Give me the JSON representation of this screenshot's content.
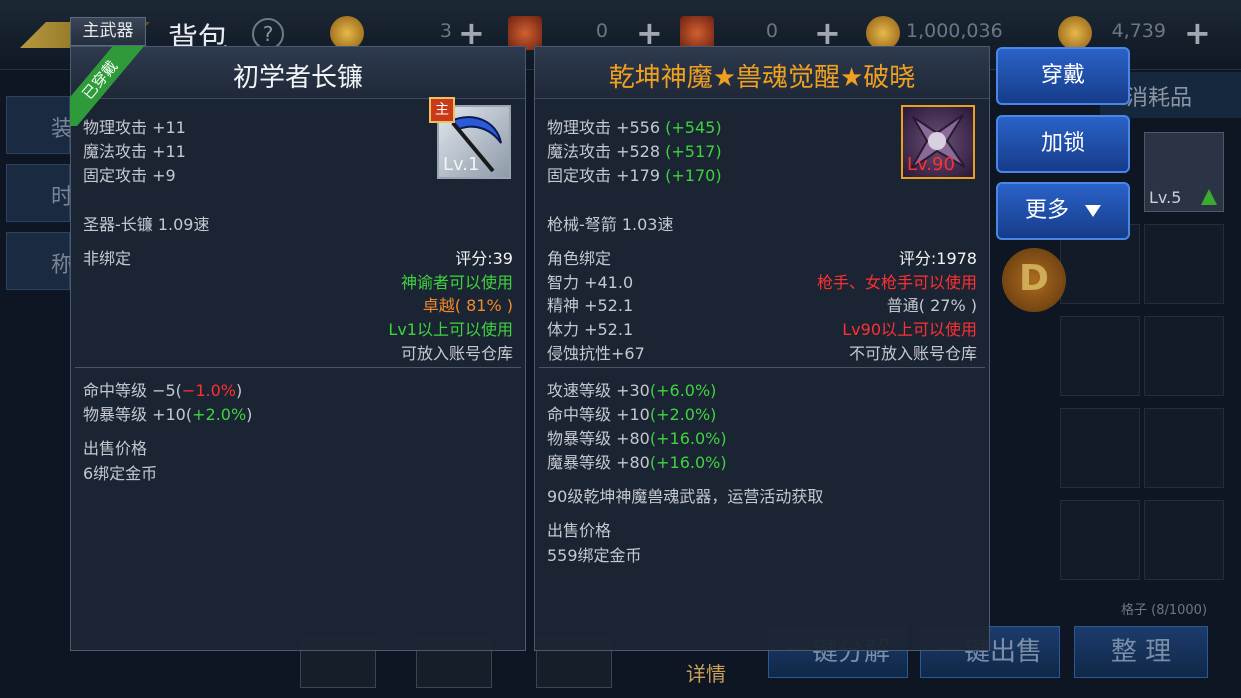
{
  "background": {
    "title": "背包",
    "help": "?",
    "resources": [
      {
        "icon": "coin-icon",
        "value": "3"
      },
      {
        "icon": "scroll-icon",
        "value": "0"
      },
      {
        "icon": "scroll-icon",
        "value": "0"
      },
      {
        "icon": "gold-coin-icon",
        "value": "1,000,036"
      },
      {
        "icon": "coin-icon",
        "value": "4,739"
      }
    ],
    "plus": "+",
    "side_tabs": [
      "装",
      "时",
      "称"
    ],
    "tab_consumables": "消耗品",
    "slot_level": "Lv.5",
    "d_badge": "D",
    "grid_count": "格子 (8/1000)",
    "bottom_buttons": [
      "一键分解",
      "一键出售",
      "整 理"
    ],
    "detail_label": "详情"
  },
  "left_item": {
    "equipped_tab": "主武器",
    "ribbon": "已穿戴",
    "name": "初学者长镰",
    "main_badge": "主",
    "icon_level": "Lv.1",
    "stats": [
      "物理攻击 +11",
      "魔法攻击 +11",
      "固定攻击 +9"
    ],
    "type_speed": "圣器-长镰 1.09速",
    "binding": "非绑定",
    "score": "评分:39",
    "usable_by": "神谕者可以使用",
    "quality": "卓越( 81% )",
    "level_req": "Lv1以上可以使用",
    "storage": "可放入账号仓库",
    "bonus_1_label": "命中等级 −5(",
    "bonus_1_value": "−1.0%",
    "bonus_1_close": ")",
    "bonus_2_label": "物暴等级 +10(",
    "bonus_2_value": "+2.0%",
    "bonus_2_close": ")",
    "sell_label": "出售价格",
    "sell_price": "6绑定金币"
  },
  "right_item": {
    "name": "乾坤神魔★兽魂觉醒★破晓",
    "icon_level": "Lv.90",
    "stats": [
      {
        "label": "物理攻击 +556",
        "diff": "(+545)"
      },
      {
        "label": "魔法攻击 +528",
        "diff": "(+517)"
      },
      {
        "label": "固定攻击 +179",
        "diff": "(+170)"
      }
    ],
    "type_speed": "枪械-弩箭 1.03速",
    "binding": "角色绑定",
    "score": "评分:1978",
    "attrs": [
      "智力 +41.0",
      "精神 +52.1",
      "体力 +52.1",
      "侵蚀抗性+67"
    ],
    "usable_by": "枪手、女枪手可以使用",
    "quality": "普通( 27% )",
    "level_req": "Lv90以上可以使用",
    "storage": "不可放入账号仓库",
    "bonuses": [
      {
        "label": "攻速等级 +30",
        "value": "(+6.0%)"
      },
      {
        "label": "命中等级 +10",
        "value": "(+2.0%)"
      },
      {
        "label": "物暴等级 +80",
        "value": "(+16.0%)"
      },
      {
        "label": "魔暴等级 +80",
        "value": "(+16.0%)"
      }
    ],
    "description": "90级乾坤神魔兽魂武器，运营活动获取",
    "sell_label": "出售价格",
    "sell_price": "559绑定金币"
  },
  "actions": {
    "equip": "穿戴",
    "lock": "加锁",
    "more": "更多"
  }
}
